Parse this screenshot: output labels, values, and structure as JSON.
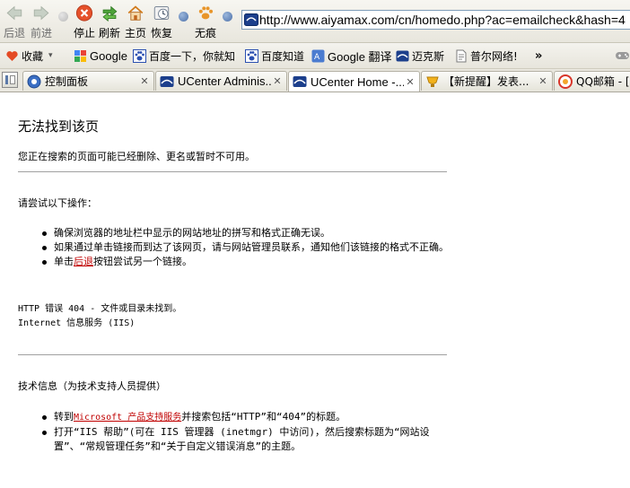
{
  "toolbar": {
    "back_label": "后退",
    "forward_label": "前进",
    "stop_label": "停止",
    "refresh_label": "刷新",
    "home_label": "主页",
    "restore_label": "恢复",
    "incognito_label": "无痕",
    "address_url": "http://www.aiyamax.com/cn/homedo.php?ac=emailcheck&hash=4"
  },
  "bookmarks": {
    "favorites_label": "收藏",
    "items": [
      {
        "label": "Google",
        "icon": "google-icon"
      },
      {
        "label": "百度一下，你就知",
        "icon": "baidu-paw-icon"
      },
      {
        "label": "百度知道",
        "icon": "baidu-paw-icon"
      },
      {
        "label": "Google 翻译",
        "icon": "translate-icon"
      },
      {
        "label": "迈克斯",
        "icon": "maxthon-icon"
      },
      {
        "label": "普尔网络!",
        "icon": "page-icon"
      }
    ],
    "more_label": "»"
  },
  "tabs": [
    {
      "title": "控制面板",
      "icon": "gear-icon"
    },
    {
      "title": "UCenter Adminis...",
      "icon": "maxthon-icon"
    },
    {
      "title": "UCenter Home -...",
      "icon": "maxthon-icon"
    },
    {
      "title": "【新提醒】发表...",
      "icon": "cup-icon"
    },
    {
      "title": "QQ邮箱 - [z",
      "icon": "qq-icon"
    }
  ],
  "page": {
    "title": "无法找到该页",
    "intro": "您正在搜索的页面可能已经删除、更名或暂时不可用。",
    "try_heading": "请尝试以下操作：",
    "try_items": [
      "确保浏览器的地址栏中显示的网站地址的拼写和格式正确无误。",
      "如果通过单击链接而到达了该网页，请与网站管理员联系，通知他们该链接的格式不正确。"
    ],
    "click_prefix": "单击",
    "back_link": "后退",
    "click_suffix": "按钮尝试另一个链接。",
    "http_error": "HTTP 错误 404 - 文件或目录未找到。",
    "iis": "Internet 信息服务 (IIS)",
    "tech_heading": "技术信息（为技术支持人员提供）",
    "tech_goto": "转到",
    "ms_link": "Microsoft 产品支持服务",
    "tech_goto_suffix": "并搜索包括“HTTP”和“404”的标题。",
    "tech_iis_help": "打开“IIS 帮助”(可在 IIS 管理器 (inetmgr) 中访问)，然后搜索标题为“网站设置”、“常规管理任务”和“关于自定义错误消息”的主题。"
  }
}
